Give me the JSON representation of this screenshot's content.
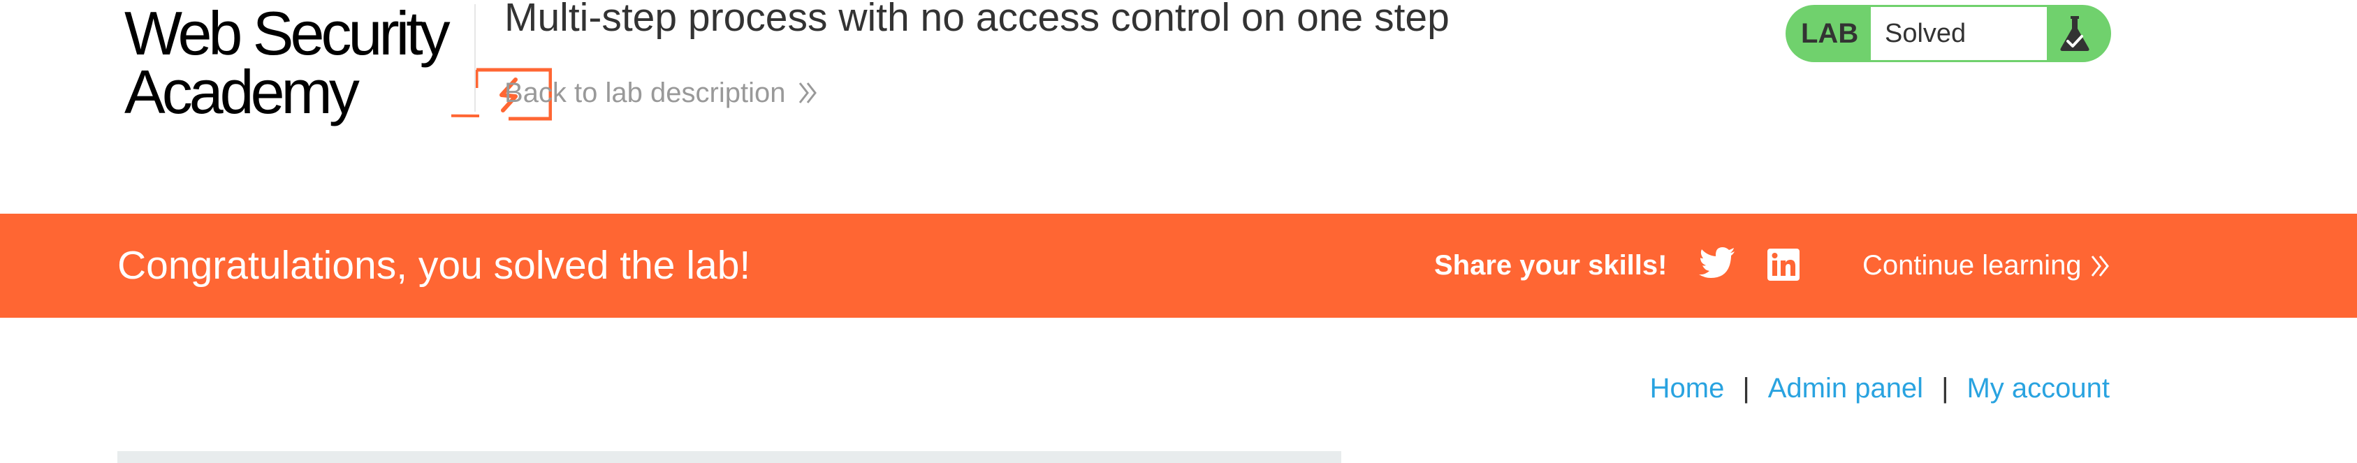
{
  "logo": {
    "line1": "Web Security",
    "line2": "Academy"
  },
  "header": {
    "lab_title": "Multi-step process with no access control on one step",
    "back_link": "Back to lab description"
  },
  "lab_status": {
    "label": "LAB",
    "state": "Solved",
    "icon": "flask-check-icon"
  },
  "banner": {
    "message": "Congratulations, you solved the lab!",
    "share_label": "Share your skills!",
    "share_icons": [
      "twitter-icon",
      "linkedin-icon"
    ],
    "continue_label": "Continue learning"
  },
  "nav": {
    "items": [
      "Home",
      "Admin panel",
      "My account"
    ],
    "separator": "|"
  },
  "colors": {
    "accent": "#ff6633",
    "status_green": "#70d16d",
    "link_blue": "#29a3e0",
    "muted_text": "#999999",
    "panel_gray": "#e8eced"
  }
}
